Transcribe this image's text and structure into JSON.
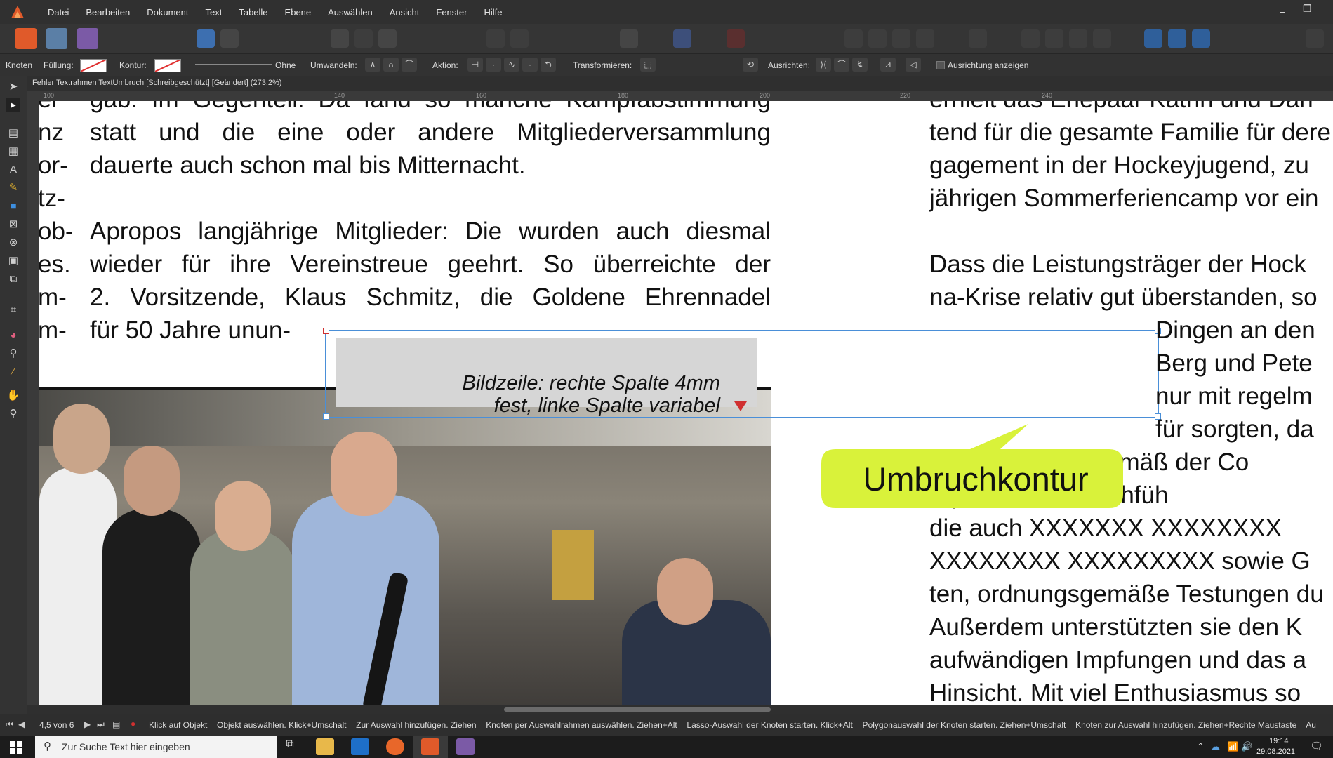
{
  "menubar": {
    "items": [
      "Datei",
      "Bearbeiten",
      "Dokument",
      "Text",
      "Tabelle",
      "Ebene",
      "Auswählen",
      "Ansicht",
      "Fenster",
      "Hilfe"
    ],
    "accent": "#e05a2a"
  },
  "context_bar": {
    "tool_name": "Knoten",
    "fill_label": "Füllung:",
    "stroke_label": "Kontur:",
    "stroke_value": "Ohne",
    "convert_label": "Umwandeln:",
    "action_label": "Aktion:",
    "transform_label": "Transformieren:",
    "align_label": "Ausrichten:",
    "show_alignment_label": "Ausrichtung anzeigen"
  },
  "document": {
    "title": "Fehler Textrahmen TextUmbruch [Schreibgeschützt] [Geändert] (273.2%)"
  },
  "ruler": {
    "ticks": [
      "100",
      "140",
      "160",
      "180",
      "200",
      "220",
      "240"
    ]
  },
  "page": {
    "left_margin_fragments": [
      "er",
      "nz",
      "or-",
      "tz-",
      "ob-",
      "es.",
      "m-",
      "m-"
    ],
    "left_column": [
      "gab. Im Gegenteil: Da fand so manche Kampfabstimmung",
      "statt und die eine oder andere Mitgliederversammlung",
      "dauerte auch schon mal bis Mitternacht.",
      "",
      "Apropos langjährige Mitglieder: Die wurden auch diesmal",
      "wieder für ihre Vereinstreue geehrt. So überreichte der",
      "2. Vorsitzende, Klaus Schmitz, die Goldene Ehrennadel",
      "für 50 Jahre unun-"
    ],
    "caption_line1": "Bildzeile: rechte Spalte 4mm",
    "caption_line2": "fest, linke Spalte variabel",
    "right_column_top": [
      "erhielt das Ehepaar Katrin und Dan",
      "tend für die gesamte Familie für dere",
      "gagement in der Hockeyjugend, zu",
      "jährigen Sommerferiencamp vor ein",
      "",
      "Dass die Leistungsträger der Hock",
      "na-Krise relativ gut überstanden, so"
    ],
    "right_column_wrapped": [
      "Dingen an den",
      "Berg und Pete",
      "nur mit regelm",
      "für sorgten, da"
    ],
    "right_column_bottom": [
      "l      der Abteilung gemäß der Co",
      "                              örperkontakt durchfüh",
      "die  auch  XXXXXXX  XXXXXXXX",
      "XXXXXXXX XXXXXXXXX sowie G",
      "ten, ordnungsgemäße Testungen du",
      "Außerdem unterstützten sie den K",
      "aufwändigen Impfungen  und das a",
      "Hinsicht. Mit viel Enthusiasmus so"
    ],
    "callout": "Umbruchkontur",
    "callout_color": "#d9f23a",
    "selection_color": "#4a8fd8"
  },
  "status": {
    "page_indicator": "4,5 von 6",
    "hint": "Klick auf Objekt = Objekt auswählen. Klick+Umschalt = Zur Auswahl hinzufügen. Ziehen = Knoten per Auswahlrahmen auswählen. Ziehen+Alt = Lasso-Auswahl der Knoten starten. Klick+Alt = Polygonauswahl der Knoten starten. Ziehen+Umschalt = Knoten zur Auswahl hinzufügen. Ziehen+Rechte Maustaste = Au"
  },
  "taskbar": {
    "search_placeholder": "Zur Suche Text hier eingeben",
    "time": "19:14",
    "date": "29.08.2021"
  }
}
